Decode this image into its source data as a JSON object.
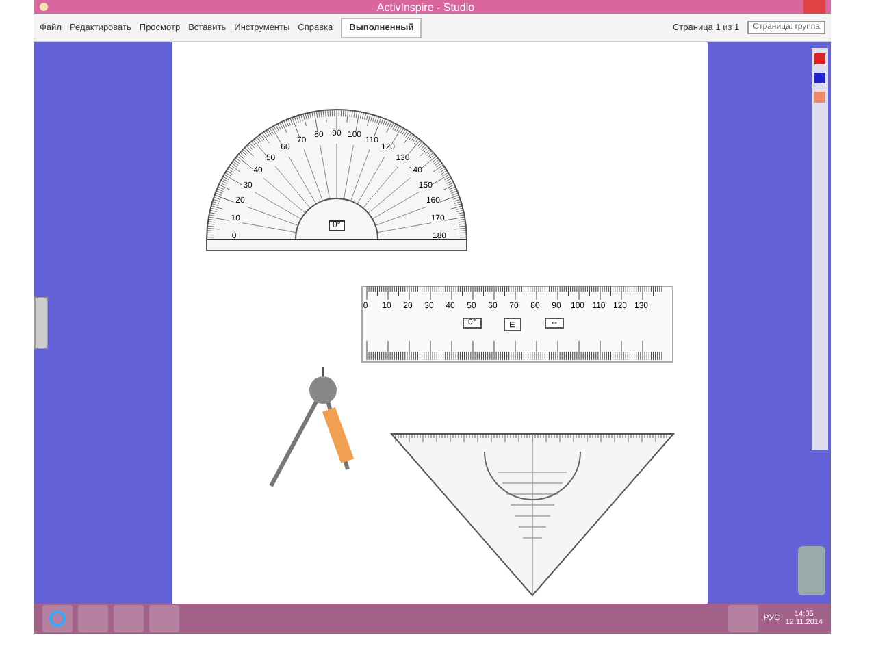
{
  "window": {
    "title": "ActivInspire - Studio"
  },
  "menu": [
    {
      "label": "Файл"
    },
    {
      "label": "Редактировать"
    },
    {
      "label": "Просмотр"
    },
    {
      "label": "Вставить"
    },
    {
      "label": "Инструменты"
    },
    {
      "label": "Справка"
    }
  ],
  "tab": {
    "label": "Выполненный",
    "selected": true
  },
  "toolbar": {
    "page_label": "Страница 1 из 1",
    "page_select": "Страница: группа"
  },
  "protractor": {
    "labels": [
      "0",
      "10",
      "20",
      "30",
      "40",
      "50",
      "60",
      "70",
      "80",
      "90",
      "100",
      "110",
      "120",
      "130",
      "140",
      "150",
      "160",
      "170",
      "180"
    ],
    "center_label": "0°"
  },
  "ruler": {
    "labels": [
      "0",
      "10",
      "20",
      "30",
      "40",
      "50",
      "60",
      "70",
      "80",
      "90",
      "100",
      "110",
      "120",
      "130"
    ],
    "buttons": [
      "0°",
      "⊟",
      "↔"
    ]
  },
  "taskbar": {
    "lang": "РУС",
    "time": "14:05",
    "date": "12.11.2014"
  }
}
